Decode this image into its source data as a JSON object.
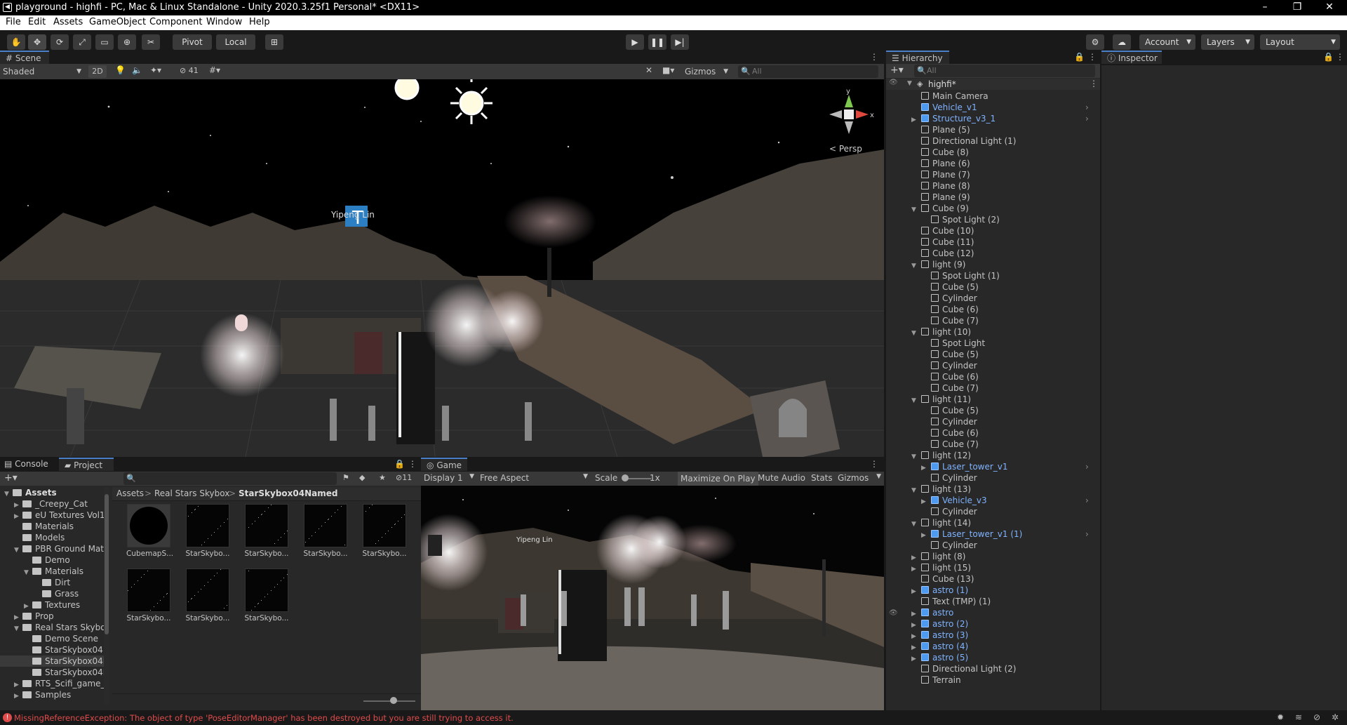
{
  "window": {
    "title": "playground - highfi - PC, Mac & Linux Standalone - Unity 2020.3.25f1 Personal* <DX11>",
    "controls": [
      "–",
      "❐",
      "✕"
    ]
  },
  "menu": [
    "File",
    "Edit",
    "Assets",
    "GameObject",
    "Component",
    "Window",
    "Help"
  ],
  "toolbar": {
    "pivot": "Pivot",
    "local": "Local",
    "account": "Account",
    "layers": "Layers",
    "layout": "Layout"
  },
  "scene": {
    "tab": "Scene",
    "shading": "Shaded",
    "mode_2d": "2D",
    "hidden_count": "41",
    "gizmos": "Gizmos",
    "search_placeholder": "All",
    "persp": "< Persp",
    "label_text": "Yipeng Lin",
    "axis_y": "y",
    "axis_x": "x"
  },
  "hierarchy": {
    "tab": "Hierarchy",
    "search_placeholder": "All",
    "root": "highfi*",
    "items": [
      {
        "label": "Main Camera",
        "depth": 1,
        "blue": false,
        "arrow": "",
        "sub": false
      },
      {
        "label": "Vehicle_v1",
        "depth": 1,
        "blue": true,
        "arrow": "",
        "sub": true
      },
      {
        "label": "Structure_v3_1",
        "depth": 1,
        "blue": true,
        "arrow": "▶",
        "sub": true
      },
      {
        "label": "Plane (5)",
        "depth": 1,
        "blue": false,
        "arrow": "",
        "sub": false
      },
      {
        "label": "Directional Light (1)",
        "depth": 1,
        "blue": false,
        "arrow": "",
        "sub": false
      },
      {
        "label": "Cube (8)",
        "depth": 1,
        "blue": false,
        "arrow": "",
        "sub": false
      },
      {
        "label": "Plane (6)",
        "depth": 1,
        "blue": false,
        "arrow": "",
        "sub": false
      },
      {
        "label": "Plane (7)",
        "depth": 1,
        "blue": false,
        "arrow": "",
        "sub": false
      },
      {
        "label": "Plane (8)",
        "depth": 1,
        "blue": false,
        "arrow": "",
        "sub": false
      },
      {
        "label": "Plane (9)",
        "depth": 1,
        "blue": false,
        "arrow": "",
        "sub": false
      },
      {
        "label": "Cube (9)",
        "depth": 1,
        "blue": false,
        "arrow": "▼",
        "sub": false
      },
      {
        "label": "Spot Light (2)",
        "depth": 2,
        "blue": false,
        "arrow": "",
        "sub": false
      },
      {
        "label": "Cube (10)",
        "depth": 1,
        "blue": false,
        "arrow": "",
        "sub": false
      },
      {
        "label": "Cube (11)",
        "depth": 1,
        "blue": false,
        "arrow": "",
        "sub": false
      },
      {
        "label": "Cube (12)",
        "depth": 1,
        "blue": false,
        "arrow": "",
        "sub": false
      },
      {
        "label": "light (9)",
        "depth": 1,
        "blue": false,
        "arrow": "▼",
        "sub": false
      },
      {
        "label": "Spot Light (1)",
        "depth": 2,
        "blue": false,
        "arrow": "",
        "sub": false
      },
      {
        "label": "Cube (5)",
        "depth": 2,
        "blue": false,
        "arrow": "",
        "sub": false
      },
      {
        "label": "Cylinder",
        "depth": 2,
        "blue": false,
        "arrow": "",
        "sub": false
      },
      {
        "label": "Cube (6)",
        "depth": 2,
        "blue": false,
        "arrow": "",
        "sub": false
      },
      {
        "label": "Cube (7)",
        "depth": 2,
        "blue": false,
        "arrow": "",
        "sub": false
      },
      {
        "label": "light (10)",
        "depth": 1,
        "blue": false,
        "arrow": "▼",
        "sub": false
      },
      {
        "label": "Spot Light",
        "depth": 2,
        "blue": false,
        "arrow": "",
        "sub": false
      },
      {
        "label": "Cube (5)",
        "depth": 2,
        "blue": false,
        "arrow": "",
        "sub": false
      },
      {
        "label": "Cylinder",
        "depth": 2,
        "blue": false,
        "arrow": "",
        "sub": false
      },
      {
        "label": "Cube (6)",
        "depth": 2,
        "blue": false,
        "arrow": "",
        "sub": false
      },
      {
        "label": "Cube (7)",
        "depth": 2,
        "blue": false,
        "arrow": "",
        "sub": false
      },
      {
        "label": "light (11)",
        "depth": 1,
        "blue": false,
        "arrow": "▼",
        "sub": false
      },
      {
        "label": "Cube (5)",
        "depth": 2,
        "blue": false,
        "arrow": "",
        "sub": false
      },
      {
        "label": "Cylinder",
        "depth": 2,
        "blue": false,
        "arrow": "",
        "sub": false
      },
      {
        "label": "Cube (6)",
        "depth": 2,
        "blue": false,
        "arrow": "",
        "sub": false
      },
      {
        "label": "Cube (7)",
        "depth": 2,
        "blue": false,
        "arrow": "",
        "sub": false
      },
      {
        "label": "light (12)",
        "depth": 1,
        "blue": false,
        "arrow": "▼",
        "sub": false
      },
      {
        "label": "Laser_tower_v1",
        "depth": 2,
        "blue": true,
        "arrow": "▶",
        "sub": true
      },
      {
        "label": "Cylinder",
        "depth": 2,
        "blue": false,
        "arrow": "",
        "sub": false
      },
      {
        "label": "light (13)",
        "depth": 1,
        "blue": false,
        "arrow": "▼",
        "sub": false
      },
      {
        "label": "Vehicle_v3",
        "depth": 2,
        "blue": true,
        "arrow": "▶",
        "sub": true
      },
      {
        "label": "Cylinder",
        "depth": 2,
        "blue": false,
        "arrow": "",
        "sub": false
      },
      {
        "label": "light (14)",
        "depth": 1,
        "blue": false,
        "arrow": "▼",
        "sub": false
      },
      {
        "label": "Laser_tower_v1 (1)",
        "depth": 2,
        "blue": true,
        "arrow": "▶",
        "sub": true
      },
      {
        "label": "Cylinder",
        "depth": 2,
        "blue": false,
        "arrow": "",
        "sub": false
      },
      {
        "label": "light (8)",
        "depth": 1,
        "blue": false,
        "arrow": "▶",
        "sub": false
      },
      {
        "label": "light (15)",
        "depth": 1,
        "blue": false,
        "arrow": "▶",
        "sub": false
      },
      {
        "label": "Cube (13)",
        "depth": 1,
        "blue": false,
        "arrow": "",
        "sub": false
      },
      {
        "label": "astro (1)",
        "depth": 1,
        "blue": true,
        "arrow": "▶",
        "sub": false
      },
      {
        "label": "Text (TMP) (1)",
        "depth": 1,
        "blue": false,
        "arrow": "",
        "sub": false
      },
      {
        "label": "astro",
        "depth": 1,
        "blue": true,
        "arrow": "▶",
        "sub": false
      },
      {
        "label": "astro (2)",
        "depth": 1,
        "blue": true,
        "arrow": "▶",
        "sub": false
      },
      {
        "label": "astro (3)",
        "depth": 1,
        "blue": true,
        "arrow": "▶",
        "sub": false
      },
      {
        "label": "astro (4)",
        "depth": 1,
        "blue": true,
        "arrow": "▶",
        "sub": false
      },
      {
        "label": "astro (5)",
        "depth": 1,
        "blue": true,
        "arrow": "▶",
        "sub": false
      },
      {
        "label": "Directional Light (2)",
        "depth": 1,
        "blue": false,
        "arrow": "",
        "sub": false
      },
      {
        "label": "Terrain",
        "depth": 1,
        "blue": false,
        "arrow": "",
        "sub": false
      }
    ]
  },
  "inspector": {
    "tab": "Inspector"
  },
  "bottom_tabs": {
    "console": "Console",
    "project": "Project"
  },
  "project": {
    "hidden_count": "11",
    "breadcrumb": [
      "Assets",
      "Real Stars Skybox",
      "StarSkybox04Named"
    ],
    "tree": [
      {
        "label": "Assets",
        "depth": 0,
        "arrow": "▼",
        "bold": true
      },
      {
        "label": "_Creepy_Cat",
        "depth": 1,
        "arrow": "▶",
        "bold": false
      },
      {
        "label": "eU Textures Vol1",
        "depth": 1,
        "arrow": "▶",
        "bold": false
      },
      {
        "label": "Materials",
        "depth": 1,
        "arrow": "",
        "bold": false
      },
      {
        "label": "Models",
        "depth": 1,
        "arrow": "",
        "bold": false
      },
      {
        "label": "PBR Ground Mate",
        "depth": 1,
        "arrow": "▼",
        "bold": false
      },
      {
        "label": "Demo",
        "depth": 2,
        "arrow": "",
        "bold": false
      },
      {
        "label": "Materials",
        "depth": 2,
        "arrow": "▼",
        "bold": false
      },
      {
        "label": "Dirt",
        "depth": 3,
        "arrow": "",
        "bold": false
      },
      {
        "label": "Grass",
        "depth": 3,
        "arrow": "",
        "bold": false
      },
      {
        "label": "Textures",
        "depth": 2,
        "arrow": "▶",
        "bold": false
      },
      {
        "label": "Prop",
        "depth": 1,
        "arrow": "▶",
        "bold": false
      },
      {
        "label": "Real Stars Skybo:",
        "depth": 1,
        "arrow": "▼",
        "bold": false
      },
      {
        "label": "Demo Scene",
        "depth": 2,
        "arrow": "",
        "bold": false
      },
      {
        "label": "StarSkybox04",
        "depth": 2,
        "arrow": "",
        "bold": false
      },
      {
        "label": "StarSkybox04N",
        "depth": 2,
        "arrow": "",
        "bold": false
      },
      {
        "label": "StarSkybox04N",
        "depth": 2,
        "arrow": "",
        "bold": false
      },
      {
        "label": "RTS_Scifi_game_a",
        "depth": 1,
        "arrow": "▶",
        "bold": false
      },
      {
        "label": "Samples",
        "depth": 1,
        "arrow": "▶",
        "bold": false
      }
    ],
    "assets": [
      "CubemapS...",
      "StarSkybo...",
      "StarSkybo...",
      "StarSkybo...",
      "StarSkybo...",
      "StarSkybo...",
      "StarSkybo...",
      "StarSkybo..."
    ]
  },
  "game": {
    "tab": "Game",
    "display": "Display 1",
    "aspect": "Free Aspect",
    "scale_label": "Scale",
    "scale_value": "1x",
    "maximize": "Maximize On Play",
    "mute": "Mute Audio",
    "stats": "Stats",
    "gizmos": "Gizmos",
    "label_text": "Yipeng Lin"
  },
  "status": {
    "message": "MissingReferenceException: The object of type 'PoseEditorManager' has been destroyed but you are still trying to access it."
  },
  "colors": {
    "accent": "#4a80c8",
    "error": "#e04b4b",
    "prefab": "#7fb3ff"
  }
}
